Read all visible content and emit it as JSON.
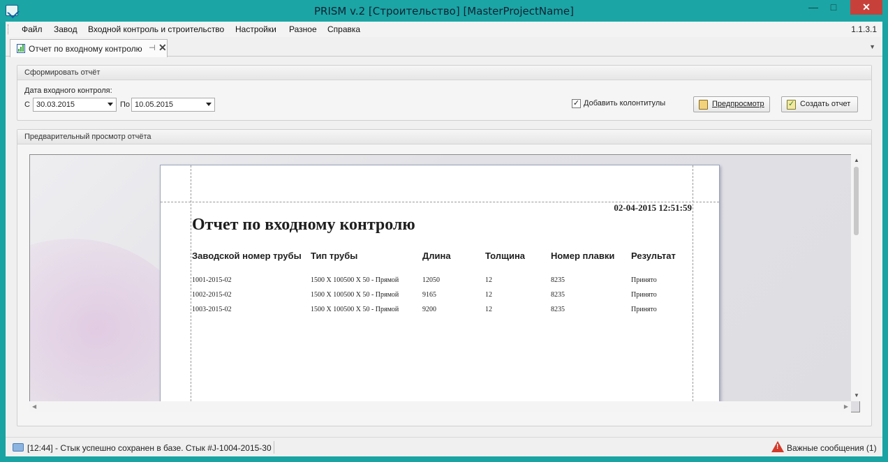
{
  "window": {
    "title": "PRISM v.2 [Строительство] [MasterProjectName]",
    "min_glyph": "—",
    "max_glyph": "□",
    "close_glyph": "✕"
  },
  "menu": {
    "items": [
      "Файл",
      "Завод",
      "Входной контроль и строительство",
      "Настройки",
      "Разное",
      "Справка"
    ],
    "version": "1.1.3.1"
  },
  "tab": {
    "label": "Отчет по входному контролю",
    "pin": "⊣",
    "close": "✕",
    "dropdown": "▼"
  },
  "form_group": {
    "header": "Сформировать отчёт",
    "date_label": "Дата входного контроля:",
    "from_label": "С",
    "from_value": "30.03.2015",
    "to_label": "По",
    "to_value": "10.05.2015",
    "headers_footers_label": "Добавить колонтитулы",
    "headers_footers_checked": true,
    "check_glyph": "✓",
    "preview_button": "Предпросмотр",
    "create_button": "Создать отчет"
  },
  "preview_group": {
    "header": "Предварительный просмотр отчёта",
    "scroll_up": "▲",
    "scroll_down": "▼",
    "scroll_left": "◀",
    "scroll_right": "▶"
  },
  "report": {
    "timestamp": "02-04-2015 12:51:59",
    "title": "Отчет по входному контролю",
    "columns": [
      "Заводской номер трубы",
      "Тип трубы",
      "Длина",
      "Толщина",
      "Номер плавки",
      "Результат"
    ],
    "rows": [
      [
        "1001-2015-02",
        "1500 X 100500 X 50 - Прямой",
        "12050",
        "12",
        "8235",
        "Принято"
      ],
      [
        "1002-2015-02",
        "1500 X 100500 X 50 - Прямой",
        "9165",
        "12",
        "8235",
        "Принято"
      ],
      [
        "1003-2015-02",
        "1500 X 100500 X 50 - Прямой",
        "9200",
        "12",
        "8235",
        "Принято"
      ]
    ]
  },
  "status": {
    "message": "[12:44] - Стык успешно сохранен в базе. Стык  #J-1004-2015-30",
    "important": "Важные сообщения (1)"
  }
}
